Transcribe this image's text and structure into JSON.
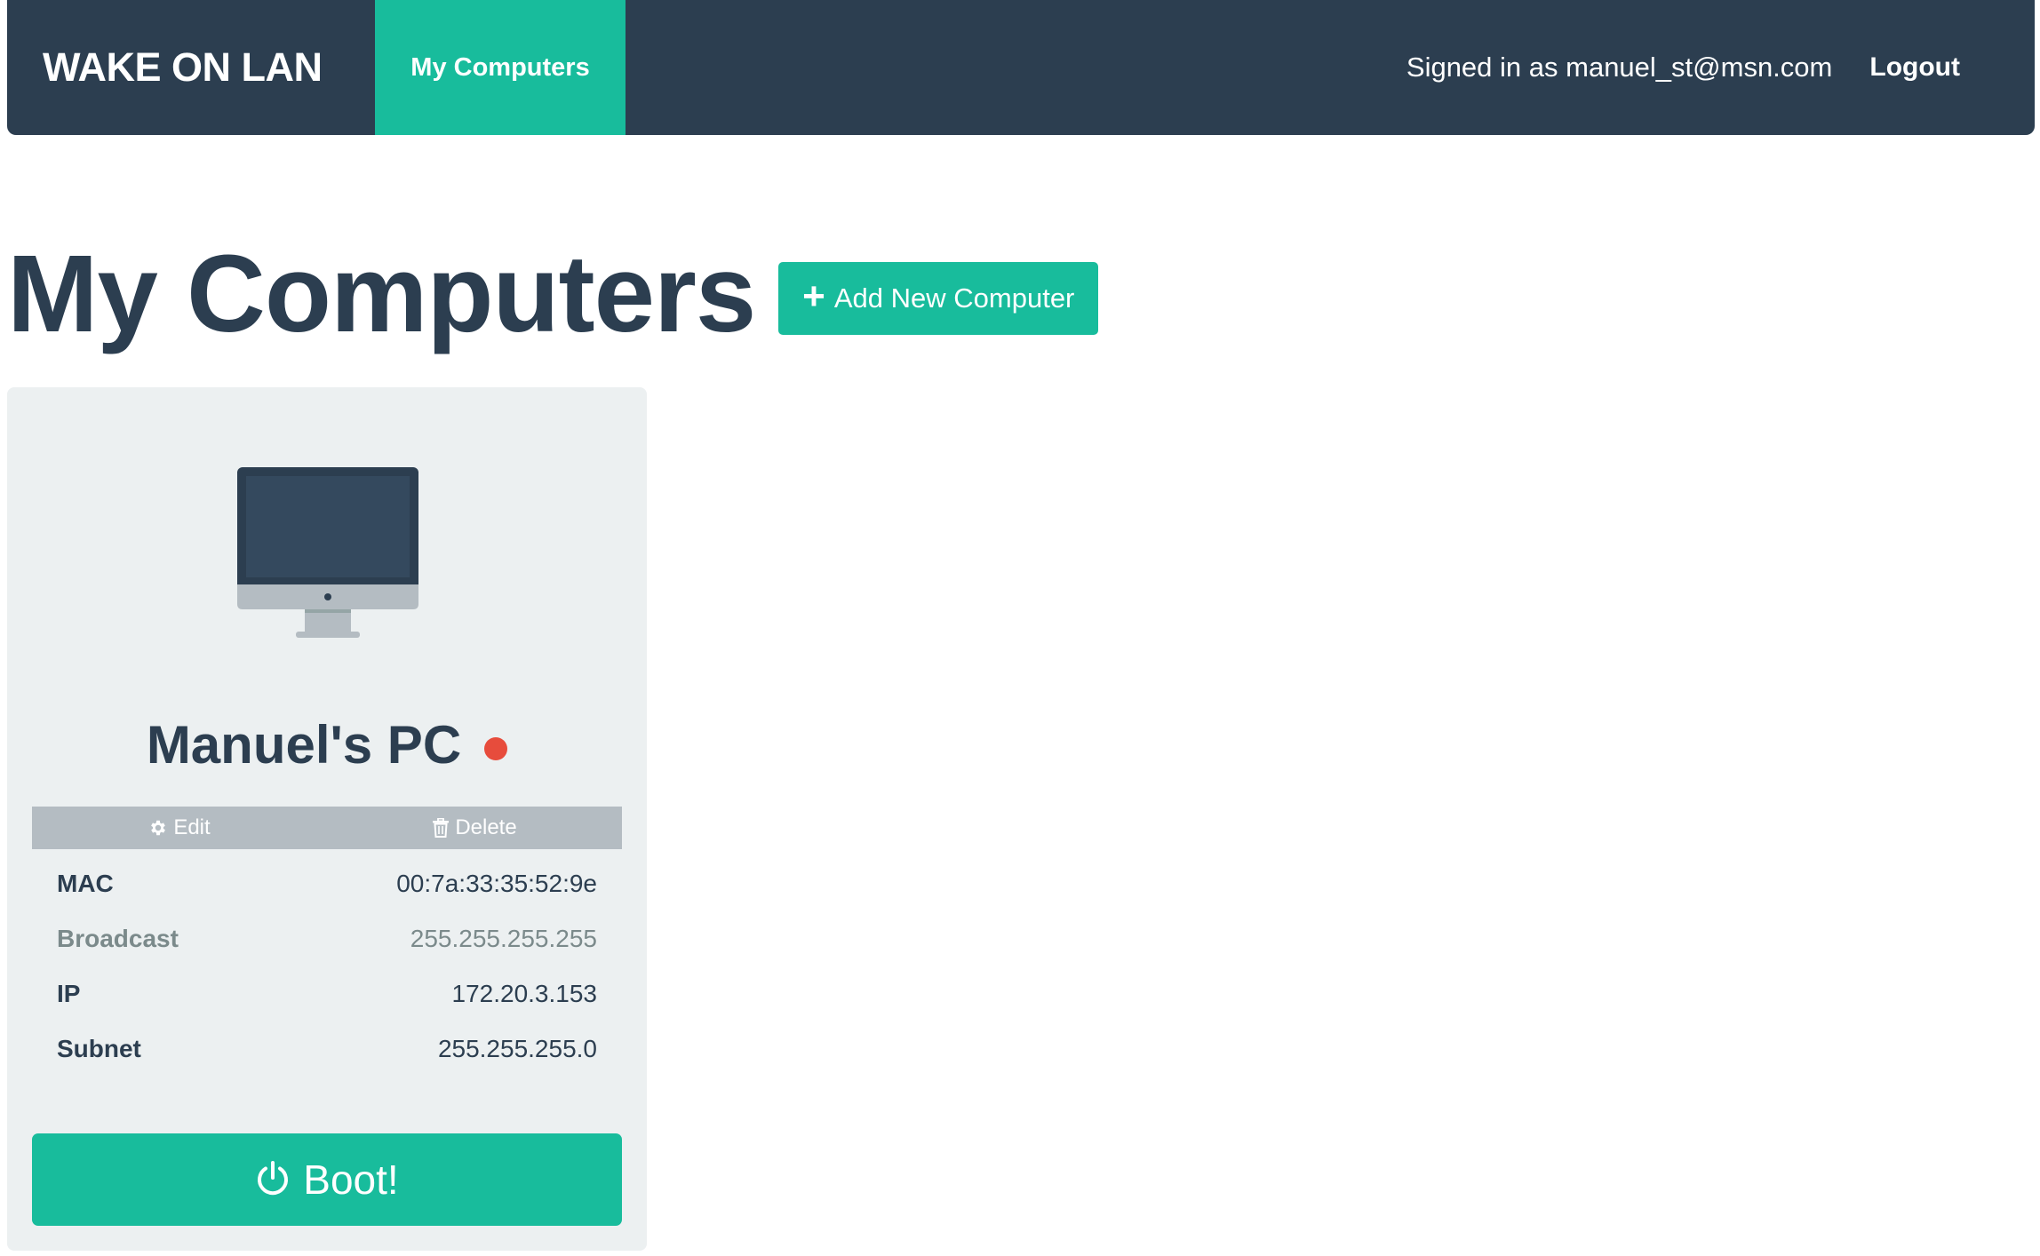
{
  "navbar": {
    "brand": "WAKE ON LAN",
    "active_tab": "My Computers",
    "signed_in_text": "Signed in as manuel_st@msn.com",
    "logout_label": "Logout",
    "background_color": "#2c3e50",
    "accent_color": "#18bc9c"
  },
  "header": {
    "title": "My Computers",
    "add_button_label": "Add New Computer",
    "add_button_icon": "plus-icon"
  },
  "computers": [
    {
      "name": "Manuel's PC",
      "icon": "desktop-computer-icon",
      "status": "offline",
      "status_color": "#e74c3c",
      "actions": {
        "edit_label": "Edit",
        "edit_icon": "gear-icon",
        "delete_label": "Delete",
        "delete_icon": "trash-icon"
      },
      "details": [
        {
          "label": "MAC",
          "value": "00:7a:33:35:52:9e"
        },
        {
          "label": "Broadcast",
          "value": "255.255.255.255"
        },
        {
          "label": "IP",
          "value": "172.20.3.153"
        },
        {
          "label": "Subnet",
          "value": "255.255.255.0"
        }
      ],
      "boot_label": "Boot!",
      "boot_icon": "power-icon"
    }
  ]
}
